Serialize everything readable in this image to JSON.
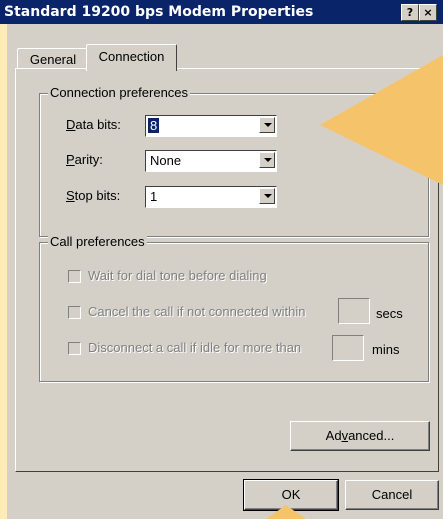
{
  "window": {
    "title": "Standard 19200 bps Modem Properties",
    "help_label": "?",
    "close_label": "×"
  },
  "tabs": [
    {
      "label": "General",
      "active": false
    },
    {
      "label": "Connection",
      "active": true
    }
  ],
  "connection_preferences": {
    "legend": "Connection preferences",
    "data_bits": {
      "label_accel": "D",
      "label_rest": "ata bits:",
      "value": "8"
    },
    "parity": {
      "label_accel": "P",
      "label_rest": "arity:",
      "value": "None"
    },
    "stop_bits": {
      "label_accel": "S",
      "label_rest": "top bits:",
      "value": "1"
    }
  },
  "call_preferences": {
    "legend": "Call preferences",
    "wait_dial_tone": {
      "label": "Wait for dial tone before dialing",
      "checked": false,
      "enabled": false
    },
    "cancel_call": {
      "label": "Cancel the call if not connected within",
      "unit": "secs",
      "checked": false,
      "enabled": false
    },
    "disconnect_idle": {
      "label": "Disconnect a call if idle for more than",
      "unit": "mins",
      "checked": false,
      "enabled": false
    }
  },
  "buttons": {
    "advanced_pre": "Ad",
    "advanced_accel": "v",
    "advanced_post": "anced...",
    "ok": "OK",
    "cancel": "Cancel"
  },
  "colors": {
    "callout": "#f5c36a",
    "background": "#fdebb8",
    "titlebar": "#0a246a",
    "dialog": "#d4d0c8"
  }
}
